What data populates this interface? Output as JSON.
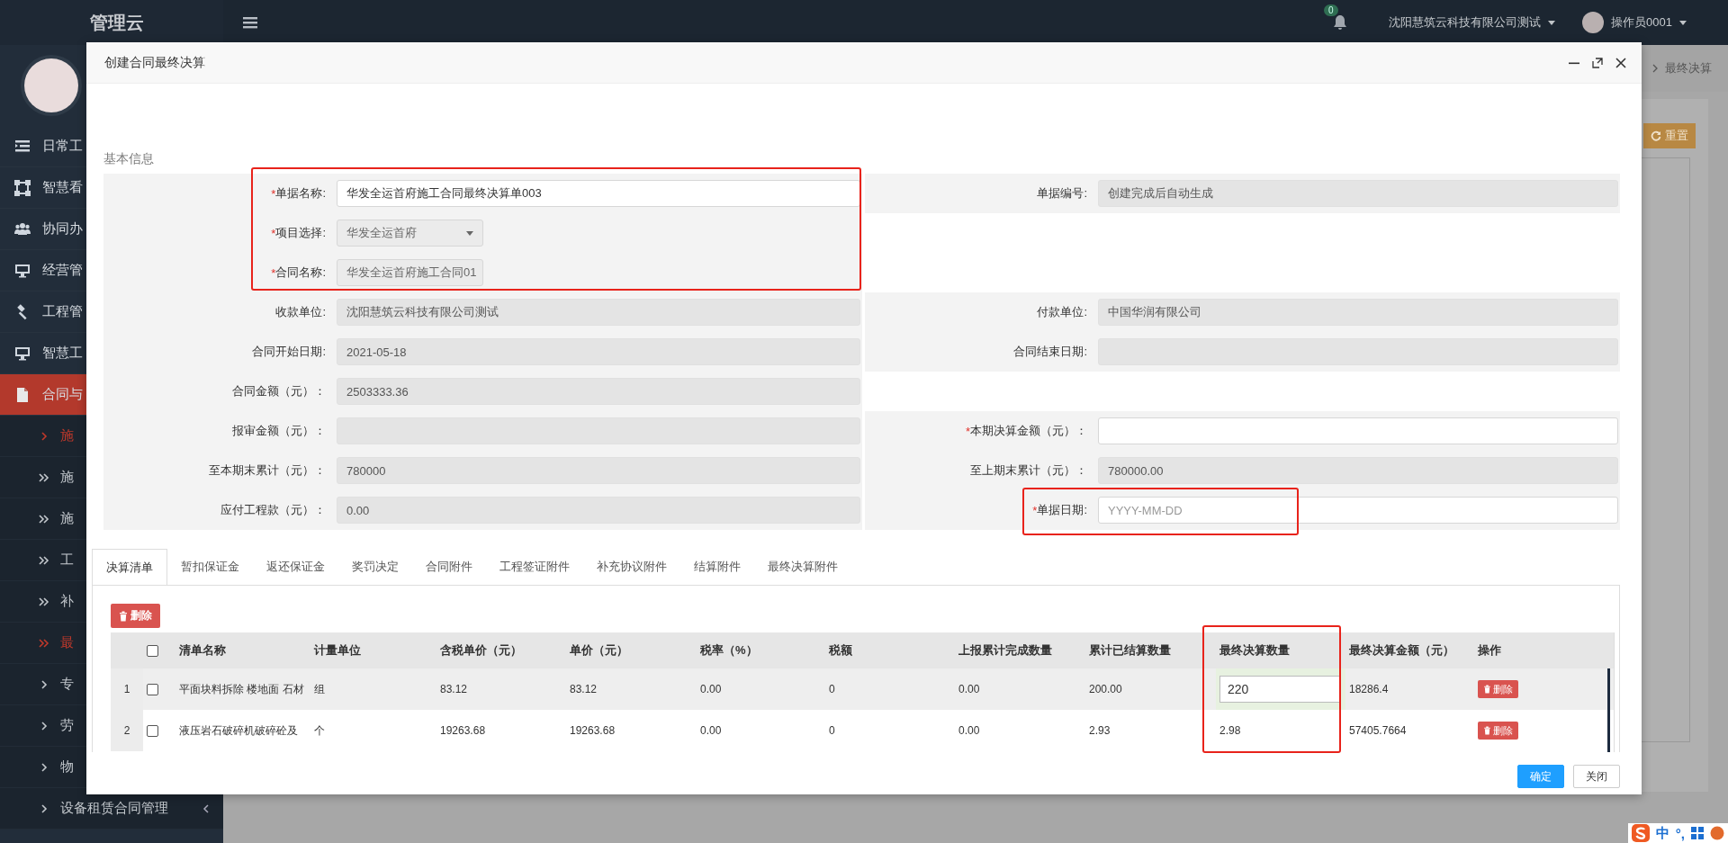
{
  "app": {
    "logo": "管理云"
  },
  "sidebar": {
    "items": [
      {
        "label": "日常工",
        "kind": "list",
        "selected": false
      },
      {
        "label": "智慧看",
        "kind": "frame",
        "selected": false
      },
      {
        "label": "协同办",
        "kind": "users",
        "selected": false
      },
      {
        "label": "经营管",
        "kind": "monitor",
        "selected": false
      },
      {
        "label": "工程管",
        "kind": "gavel",
        "selected": false
      },
      {
        "label": "智慧工",
        "kind": "monitor",
        "selected": false
      },
      {
        "label": "合同与",
        "kind": "file",
        "selected": true,
        "children": [
          {
            "label": "施",
            "kind": "single",
            "selected": true
          },
          {
            "label": "施",
            "kind": "double",
            "selected": false
          },
          {
            "label": "施",
            "kind": "double",
            "selected": false
          },
          {
            "label": "工",
            "kind": "double",
            "selected": false
          },
          {
            "label": "补",
            "kind": "double",
            "selected": false
          },
          {
            "label": "最",
            "kind": "double",
            "selected": true
          },
          {
            "label": "专",
            "kind": "single",
            "selected": false
          },
          {
            "label": "劳",
            "kind": "single",
            "selected": false
          },
          {
            "label": "物",
            "kind": "single",
            "selected": false
          },
          {
            "label": "设备租赁合同管理",
            "kind": "single",
            "selected": false,
            "expandable": true
          }
        ]
      }
    ]
  },
  "header": {
    "notifications": "0",
    "company": "沈阳慧筑云科技有限公司测试",
    "user": "操作员0001"
  },
  "background": {
    "breadcrumb": "最终决算",
    "reset_button": "重置"
  },
  "modal": {
    "title": "创建合同最终决算",
    "section_title": "基本信息",
    "form": {
      "rows": [
        {
          "left": {
            "mark": "*",
            "label": "单据名称:",
            "kind": "text",
            "disabled": false,
            "value": "华发全运首府施工合同最终决算单003"
          },
          "right": {
            "label": "单据编号:",
            "kind": "text",
            "disabled": true,
            "value": "创建完成后自动生成"
          }
        },
        {
          "left": {
            "mark": "*",
            "label": "项目选择:",
            "kind": "select",
            "disabled": true,
            "value": "华发全运首府"
          }
        },
        {
          "left": {
            "mark": "*",
            "label": "合同名称:",
            "kind": "select",
            "disabled": true,
            "value": "华发全运首府施工合同01"
          }
        },
        {
          "left": {
            "label": "收款单位:",
            "kind": "text",
            "disabled": true,
            "value": "沈阳慧筑云科技有限公司测试"
          },
          "right": {
            "label": "付款单位:",
            "kind": "text",
            "disabled": true,
            "value": "中国华润有限公司"
          }
        },
        {
          "left": {
            "label": "合同开始日期:",
            "kind": "text",
            "disabled": true,
            "value": "2021-05-18"
          },
          "right": {
            "label": "合同结束日期:",
            "kind": "text",
            "disabled": true
          }
        },
        {
          "left": {
            "label": "合同金额（元）：",
            "kind": "text",
            "disabled": true,
            "value": "2503333.36"
          }
        },
        {
          "left": {
            "label": "报审金额（元）：",
            "kind": "text",
            "disabled": true
          },
          "right": {
            "mark": "*",
            "label": "本期决算金额（元）：",
            "kind": "text",
            "disabled": false
          }
        },
        {
          "left": {
            "label": "至本期末累计（元）：",
            "kind": "text",
            "disabled": true,
            "value": "780000"
          },
          "right": {
            "label": "至上期末累计（元）：",
            "kind": "text",
            "disabled": true,
            "value": "780000.00"
          }
        },
        {
          "left": {
            "label": "应付工程款（元）：",
            "kind": "text",
            "disabled": true,
            "value": "0.00"
          },
          "right": {
            "mark": "*",
            "label": "单据日期:",
            "kind": "text",
            "disabled": false,
            "placeholder": "YYYY-MM-DD"
          }
        }
      ]
    },
    "tabs": [
      {
        "label": "决算清单",
        "selected": true
      },
      {
        "label": "暂扣保证金",
        "selected": false
      },
      {
        "label": "返还保证金",
        "selected": false
      },
      {
        "label": "奖罚决定",
        "selected": false
      },
      {
        "label": "合同附件",
        "selected": false
      },
      {
        "label": "工程签证附件",
        "selected": false
      },
      {
        "label": "补充协议附件",
        "selected": false
      },
      {
        "label": "结算附件",
        "selected": false
      },
      {
        "label": "最终决算附件",
        "selected": false
      }
    ],
    "delete_button": "删除",
    "table": {
      "header_checked": false,
      "columns": [
        "清单名称",
        "计量单位",
        "含税单价（元）",
        "单价（元）",
        "税率（%）",
        "税额",
        "上报累计完成数量",
        "累计已结算数量",
        "最终决算数量",
        "最终决算金额（元）",
        "操作"
      ],
      "rows": [
        {
          "index": "1",
          "checked": false,
          "selected": true,
          "cells": [
            {
              "kind": "text",
              "text": "平面块料拆除 楼地面 石材"
            },
            {
              "kind": "text",
              "text": "组"
            },
            {
              "kind": "text",
              "text": "83.12"
            },
            {
              "kind": "text",
              "text": "83.12"
            },
            {
              "kind": "text",
              "text": "0.00"
            },
            {
              "kind": "text",
              "text": "0"
            },
            {
              "kind": "text",
              "text": "0.00"
            },
            {
              "kind": "text",
              "text": "200.00"
            },
            {
              "kind": "input",
              "text": "220"
            },
            {
              "kind": "text",
              "text": "18286.4"
            },
            {
              "kind": "button",
              "text": "删除"
            }
          ]
        },
        {
          "index": "2",
          "checked": false,
          "selected": false,
          "cells": [
            {
              "kind": "text",
              "text": "液压岩石破碎机破碎砼及"
            },
            {
              "kind": "text",
              "text": "个"
            },
            {
              "kind": "text",
              "text": "19263.68"
            },
            {
              "kind": "text",
              "text": "19263.68"
            },
            {
              "kind": "text",
              "text": "0.00"
            },
            {
              "kind": "text",
              "text": "0"
            },
            {
              "kind": "text",
              "text": "0.00"
            },
            {
              "kind": "text",
              "text": "2.93"
            },
            {
              "kind": "text",
              "text": "2.98"
            },
            {
              "kind": "text",
              "text": "57405.7664"
            },
            {
              "kind": "button",
              "text": "删除"
            }
          ]
        }
      ]
    },
    "buttons": [
      {
        "label": "确定",
        "kind": "primary"
      },
      {
        "label": "关闭",
        "kind": "default"
      }
    ]
  },
  "ime": {
    "items": [
      "中",
      "°,"
    ]
  }
}
